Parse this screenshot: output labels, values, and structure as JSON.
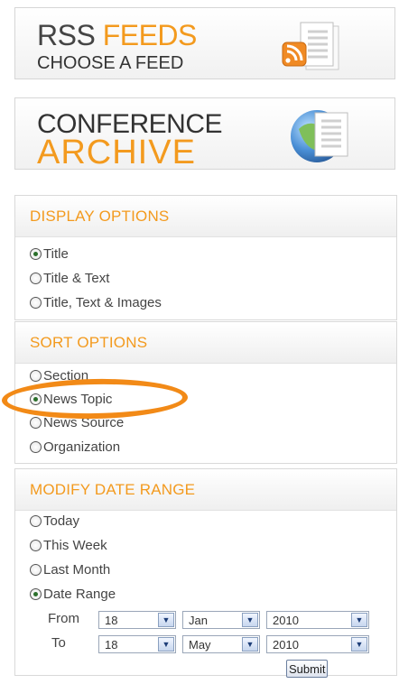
{
  "rss_banner": {
    "word1": "RSS",
    "word2": "FEEDS",
    "subtitle": "CHOOSE A FEED",
    "icon": "rss-document-icon"
  },
  "archive_banner": {
    "line1": "CONFERENCE",
    "line2": "ARCHIVE",
    "icon": "globe-document-icon"
  },
  "display_options": {
    "title": "DISPLAY OPTIONS",
    "options": [
      "Title",
      "Title & Text",
      "Title, Text & Images"
    ],
    "selected": "Title"
  },
  "sort_options": {
    "title": "SORT OPTIONS",
    "options": [
      "Section",
      "News Topic",
      "News Source",
      "Organization"
    ],
    "selected": "News Topic"
  },
  "date_range": {
    "title": "MODIFY DATE RANGE",
    "options": [
      "Today",
      "This Week",
      "Last Month",
      "Date Range"
    ],
    "selected": "Date Range",
    "from_label": "From",
    "to_label": "To",
    "from": {
      "day": "18",
      "month": "Jan",
      "year": "2010"
    },
    "to": {
      "day": "18",
      "month": "May",
      "year": "2010"
    },
    "submit_label": "Submit"
  },
  "colors": {
    "accent": "#f39a1e",
    "highlight_ellipse": "#f28a17"
  }
}
